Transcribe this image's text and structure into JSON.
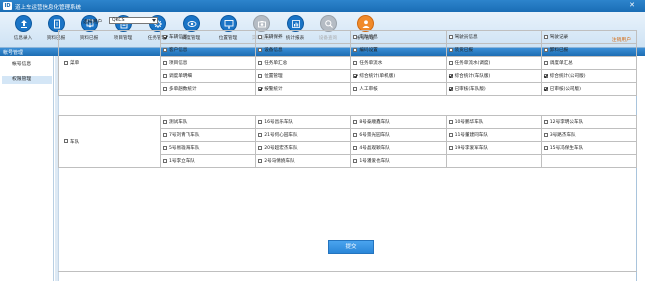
{
  "app": {
    "title": "道上车运营信息化管理系统",
    "logo": "ID",
    "close": "✕"
  },
  "toolbar": [
    {
      "label": "信息录入",
      "icon": "upload-icon",
      "disabled": false
    },
    {
      "label": "资料已报",
      "icon": "document-icon",
      "disabled": false
    },
    {
      "label": "资料已报",
      "icon": "download-icon",
      "disabled": false
    },
    {
      "label": "项目管理",
      "icon": "list-icon",
      "disabled": false
    },
    {
      "label": "任务管理",
      "icon": "gear-icon",
      "disabled": false
    },
    {
      "label": "调度管理",
      "icon": "eye-icon",
      "disabled": false
    },
    {
      "label": "位置管理",
      "icon": "monitor-icon",
      "disabled": false
    },
    {
      "label": "实时监控",
      "icon": "camera-icon",
      "disabled": true
    },
    {
      "label": "统计报表",
      "icon": "chart-icon",
      "disabled": false
    },
    {
      "label": "设备查询",
      "icon": "search-icon",
      "disabled": true
    },
    {
      "label": "帐号管理",
      "icon": "user-icon",
      "disabled": false
    }
  ],
  "user": {
    "name": "注销用户"
  },
  "panel": {
    "title": "帐号管理"
  },
  "sidebar": {
    "items": [
      {
        "label": "帐号信息"
      },
      {
        "label": "权限管理"
      }
    ]
  },
  "form": {
    "select_label": "选择用户",
    "select_value": "QKCS",
    "submit_label": "提交"
  },
  "menu": {
    "label": "菜单",
    "rows": [
      [
        {
          "t": "车辆信息",
          "c": true
        },
        {
          "t": "车辆保养",
          "c": false
        },
        {
          "t": "车队信息",
          "c": false
        },
        {
          "t": "驾驶员信息",
          "c": false
        },
        {
          "t": "驾驶记录",
          "c": false
        }
      ],
      [
        {
          "t": "客户信息",
          "c": false
        },
        {
          "t": "设备信息",
          "c": false
        },
        {
          "t": "编码设置",
          "c": false
        },
        {
          "t": "装货已报",
          "c": false
        },
        {
          "t": "卸料已报",
          "c": false
        }
      ],
      [
        {
          "t": "项目信息",
          "c": false
        },
        {
          "t": "任务单汇总",
          "c": false
        },
        {
          "t": "任务单流水",
          "c": false
        },
        {
          "t": "任务单流水(调度)",
          "c": false
        },
        {
          "t": "调度单汇总",
          "c": false
        }
      ],
      [
        {
          "t": "调度单明细",
          "c": false
        },
        {
          "t": "位置管理",
          "c": false
        },
        {
          "t": "综合统计(单机版)",
          "c": true
        },
        {
          "t": "综合统计(车队版)",
          "c": true
        },
        {
          "t": "综合统计(公司版)",
          "c": true
        }
      ],
      [
        {
          "t": "多单趟数统计",
          "c": false
        },
        {
          "t": "按警统计",
          "c": true
        },
        {
          "t": "人工审核",
          "c": false
        },
        {
          "t": "已审核(车队版)",
          "c": true
        },
        {
          "t": "已审核(公司版)",
          "c": true
        }
      ]
    ]
  },
  "fleet": {
    "label": "车队",
    "rows": [
      [
        {
          "t": "测试车队",
          "c": false
        },
        {
          "t": "16号昌乐车队",
          "c": false
        },
        {
          "t": "8号泰顺鑫车队",
          "c": false
        },
        {
          "t": "10号鹏华车队",
          "c": false
        },
        {
          "t": "12号李明公车队",
          "c": false
        }
      ],
      [
        {
          "t": "7号刘青飞车队",
          "c": false
        },
        {
          "t": "21号何心园车队",
          "c": false
        },
        {
          "t": "6号景光园车队",
          "c": false
        },
        {
          "t": "11号董建同车队",
          "c": false
        },
        {
          "t": "3号路杰车队",
          "c": false
        }
      ],
      [
        {
          "t": "5号易珑海车队",
          "c": false
        },
        {
          "t": "20号超宏杰车队",
          "c": false
        },
        {
          "t": "4号晶观颖车队",
          "c": false
        },
        {
          "t": "19号李爱军车队",
          "c": false
        },
        {
          "t": "15号冯保生车队",
          "c": false
        }
      ],
      [
        {
          "t": "1号李立车队",
          "c": false
        },
        {
          "t": "2号马倩娆车队",
          "c": false
        },
        {
          "t": "1号潘爱也车队",
          "c": false
        },
        {
          "t": "",
          "c": null
        },
        {
          "t": "",
          "c": null
        }
      ]
    ]
  }
}
